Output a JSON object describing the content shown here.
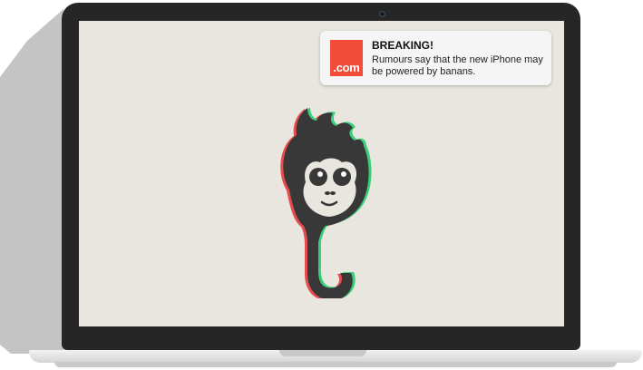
{
  "notification": {
    "app_icon_text": ".com",
    "title": "BREAKING!",
    "body": "Rumours say that the new iPhone may be powered by banans."
  },
  "colors": {
    "laptop_frame": "#262626",
    "screen_background": "#e8e6df",
    "app_icon": "#f24c38",
    "logo_dark": "#383838",
    "logo_face": "#e8e6df",
    "glitch_red": "#e64c4c",
    "glitch_green": "#3bcf7a"
  },
  "icons": [
    "monkey-logo-icon",
    "dot-com-app-icon"
  ]
}
